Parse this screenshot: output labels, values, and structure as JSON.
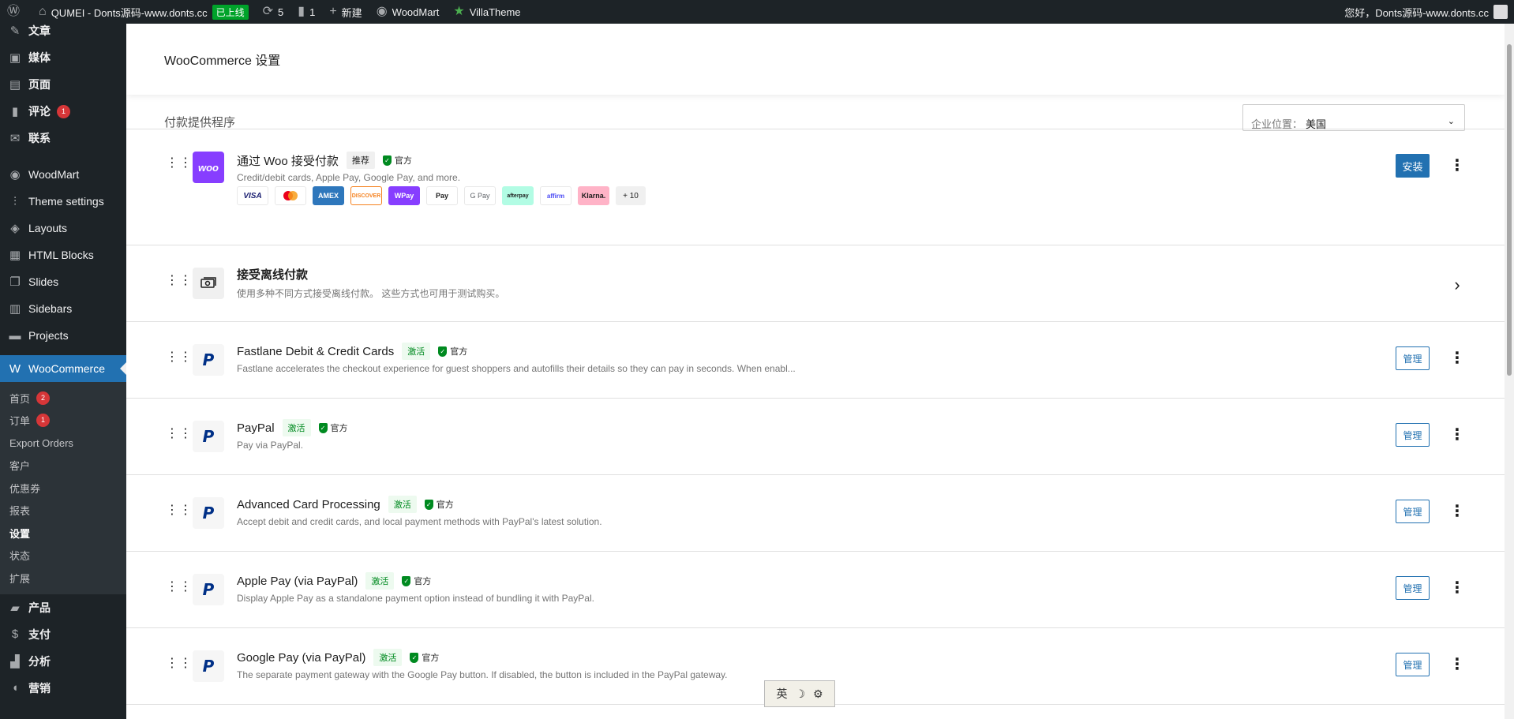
{
  "adminbar": {
    "site_name": "QUMEI - Donts源码-www.donts.cc",
    "live_badge": "已上线",
    "updates_count": "5",
    "comments_count": "1",
    "new_label": "新建",
    "woodmart_label": "WoodMart",
    "villatheme_label": "VillaTheme",
    "greeting": "您好，Donts源码-www.donts.cc"
  },
  "sidebar": {
    "items": [
      {
        "label": "文章",
        "icon": "pin-icon"
      },
      {
        "label": "媒体",
        "icon": "media-icon"
      },
      {
        "label": "页面",
        "icon": "page-icon"
      },
      {
        "label": "评论",
        "icon": "comment-icon",
        "count": "1"
      },
      {
        "label": "联系",
        "icon": "mail-icon"
      },
      {
        "label": "WoodMart",
        "icon": "woodmart-icon"
      },
      {
        "label": "Theme settings",
        "icon": "sliders-icon"
      },
      {
        "label": "Layouts",
        "icon": "layers-icon"
      },
      {
        "label": "HTML Blocks",
        "icon": "html-icon"
      },
      {
        "label": "Slides",
        "icon": "slides-icon"
      },
      {
        "label": "Sidebars",
        "icon": "sidebars-icon"
      },
      {
        "label": "Projects",
        "icon": "briefcase-icon"
      },
      {
        "label": "WooCommerce",
        "icon": "woocommerce-icon"
      }
    ],
    "woo_submenu": [
      {
        "label": "首页",
        "count": "2"
      },
      {
        "label": "订单",
        "count": "1"
      },
      {
        "label": "Export Orders"
      },
      {
        "label": "客户"
      },
      {
        "label": "优惠券"
      },
      {
        "label": "报表"
      },
      {
        "label": "设置"
      },
      {
        "label": "状态"
      },
      {
        "label": "扩展"
      }
    ],
    "bottom_items": [
      {
        "label": "产品",
        "icon": "archive-icon"
      },
      {
        "label": "支付",
        "icon": "dollar-icon"
      },
      {
        "label": "分析",
        "icon": "chart-icon"
      },
      {
        "label": "营销",
        "icon": "megaphone-icon"
      }
    ]
  },
  "header": {
    "title": "WooCommerce 设置"
  },
  "providers": {
    "title": "付款提供程序",
    "location_label": "企业位置：",
    "location_value": "美国"
  },
  "woo_payments": {
    "title": "通过 Woo 接受付款",
    "badge": "推荐",
    "official": "官方",
    "description": "Credit/debit cards, Apple Pay, Google Pay, and more.",
    "install_label": "安装",
    "methods": [
      "VISA",
      "MC",
      "AMEX",
      "DISCOVER",
      "WPay",
      "Pay",
      "G Pay",
      "afterpay",
      "affirm",
      "Klarna.",
      "+ 10"
    ]
  },
  "offline": {
    "title": "接受离线付款",
    "description": "使用多种不同方式接受离线付款。 这些方式也可用于测试购买。"
  },
  "gateways": [
    {
      "title": "Fastlane Debit & Credit Cards",
      "badge": "激活",
      "official": "官方",
      "description": "Fastlane accelerates the checkout experience for guest shoppers and autofills their details so they can pay in seconds. When enabl...",
      "manage": "管理"
    },
    {
      "title": "PayPal",
      "badge": "激活",
      "official": "官方",
      "description": "Pay via PayPal.",
      "manage": "管理"
    },
    {
      "title": "Advanced Card Processing",
      "badge": "激活",
      "official": "官方",
      "description": "Accept debit and credit cards, and local payment methods with PayPal's latest solution.",
      "manage": "管理"
    },
    {
      "title": "Apple Pay (via PayPal)",
      "badge": "激活",
      "official": "官方",
      "description": "Display Apple Pay as a standalone payment option instead of bundling it with PayPal.",
      "manage": "管理"
    },
    {
      "title": "Google Pay (via PayPal)",
      "badge": "激活",
      "official": "官方",
      "description": "The separate payment gateway with the Google Pay button. If disabled, the button is included in the PayPal gateway.",
      "manage": "管理"
    }
  ],
  "ime": {
    "label": "英"
  },
  "colors": {
    "admin_dark": "#1d2327",
    "accent": "#2271b1",
    "active_green": "#008a20",
    "woo_purple": "#873eff"
  }
}
